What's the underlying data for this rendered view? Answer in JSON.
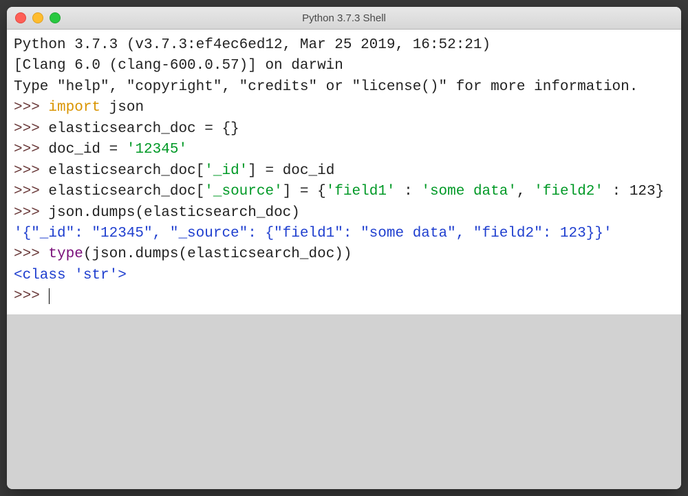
{
  "window": {
    "title": "Python 3.7.3 Shell"
  },
  "colors": {
    "close": "#ff5f57",
    "minimize": "#febc2e",
    "zoom": "#28c840"
  },
  "banner": {
    "line1": "Python 3.7.3 (v3.7.3:ef4ec6ed12, Mar 25 2019, 16:52:21) ",
    "line2": "[Clang 6.0 (clang-600.0.57)] on darwin",
    "line3_a": "Type \"help\", \"copyright\", \"credits\" or \"license()\" for more ",
    "line3_b": "information."
  },
  "session": {
    "prompt": ">>> ",
    "l1": {
      "kw": "import",
      "rest": " json"
    },
    "l2": "elasticsearch_doc = {}",
    "l3": {
      "a": "doc_id = ",
      "s": "'12345'"
    },
    "l4": {
      "a": "elasticsearch_doc[",
      "s1": "'_id'",
      "b": "] = doc_id"
    },
    "l5": {
      "a": "elasticsearch_doc[",
      "s1": "'_source'",
      "b": "] = {",
      "s2": "'field1'",
      "c": " : ",
      "s3": "'some data'",
      "d": ", ",
      "s4": "'field2'",
      "e": " : 123}"
    },
    "l6": "json.dumps(elasticsearch_doc)",
    "out1": "'{\"_id\": \"12345\", \"_source\": {\"field1\": \"some data\", \"field2\": 123}}'",
    "l7": {
      "builtin": "type",
      "rest": "(json.dumps(elasticsearch_doc))"
    },
    "out2": "<class 'str'>"
  }
}
